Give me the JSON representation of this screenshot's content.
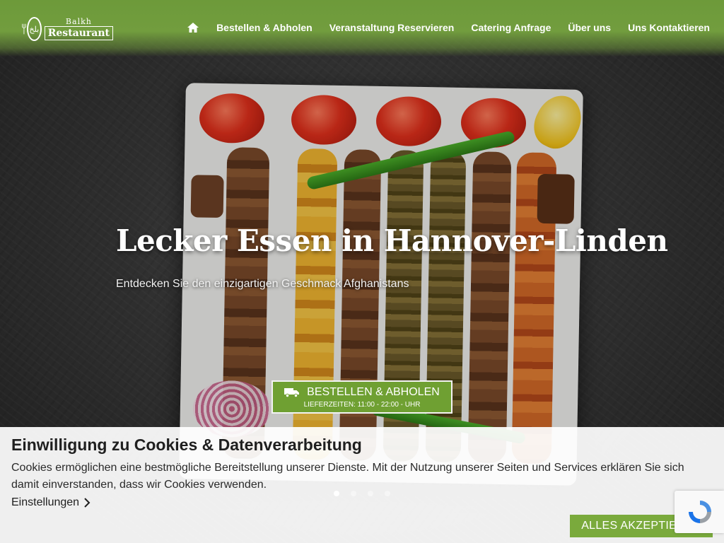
{
  "header": {
    "logo_top": "Balkh",
    "logo_main": "Restaurant",
    "logo_emblem": "بلخ",
    "nav": [
      "Bestellen & Abholen",
      "Veranstaltung Reservieren",
      "Catering Anfrage",
      "Über uns",
      "Uns Kontaktieren"
    ]
  },
  "hero": {
    "title": "Lecker Essen in Hannover-Linden",
    "subtitle": "Entdecken Sie den einzigartigen Geschmack Afghanistans",
    "cta": {
      "label": "BESTELLEN & ABHOLEN",
      "sublabel": "LIEFERZEITEN: 11:00 - 22:00 - UHR",
      "icon": "truck-icon"
    },
    "slider": {
      "count": 4,
      "active": 1
    }
  },
  "cookie": {
    "title": "Einwilligung zu Cookies & Datenverarbeitung",
    "text": "Cookies ermöglichen eine bestmögliche Bereitstellung unserer Dienste. Mit der Nutzung unserer Seiten und Services erklären Sie sich damit einverstanden, dass wir Cookies verwenden.",
    "settings_label": "Einstellungen",
    "accept_label": "ALLES AKZEPTIEREN"
  },
  "colors": {
    "brand_green": "#7aaa3c",
    "header_green": "#6d9a3a"
  }
}
